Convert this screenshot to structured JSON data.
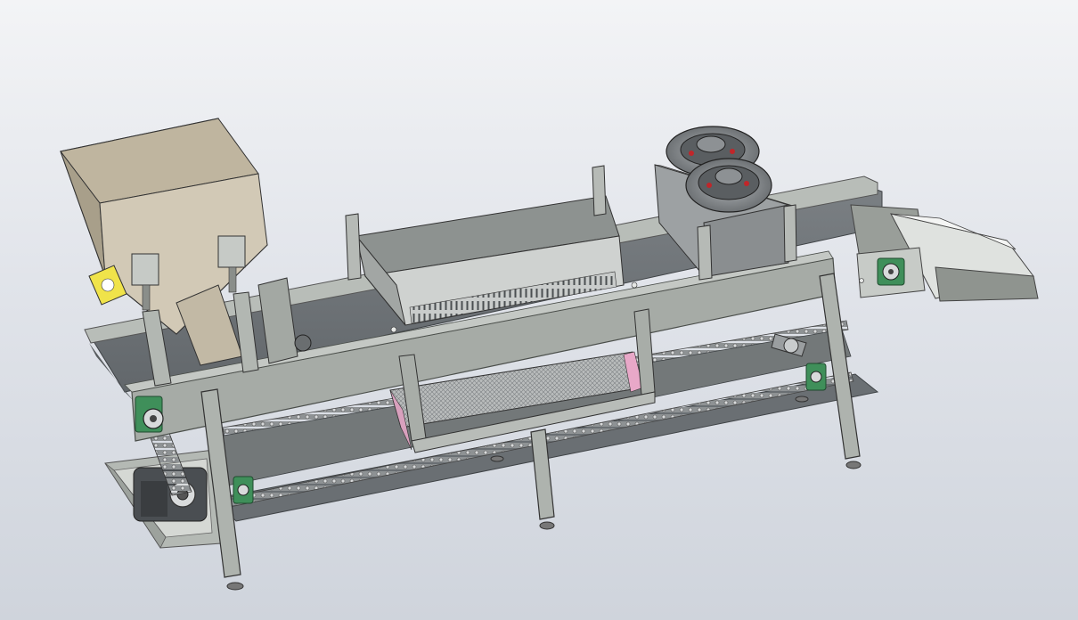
{
  "view": {
    "background_top": "#f3f4f6",
    "background_bottom": "#cfd4dc"
  },
  "model": {
    "kind": "3D CAD model of a conveyor machine",
    "colors": {
      "hopper": "#cfc6b2",
      "frame": "#a9afa9",
      "frame_dark": "#8a908a",
      "belt": "#6f7478",
      "belt_dark": "#5a5f63",
      "chain": "#9a9ea0",
      "bearing": "#3f8f5a",
      "accent_pink": "#e8a8c8",
      "accent_red": "#c0262a",
      "label_yellow": "#f0e34a",
      "motor": "#4a4e52",
      "fan_housing": "#8f9396"
    }
  }
}
